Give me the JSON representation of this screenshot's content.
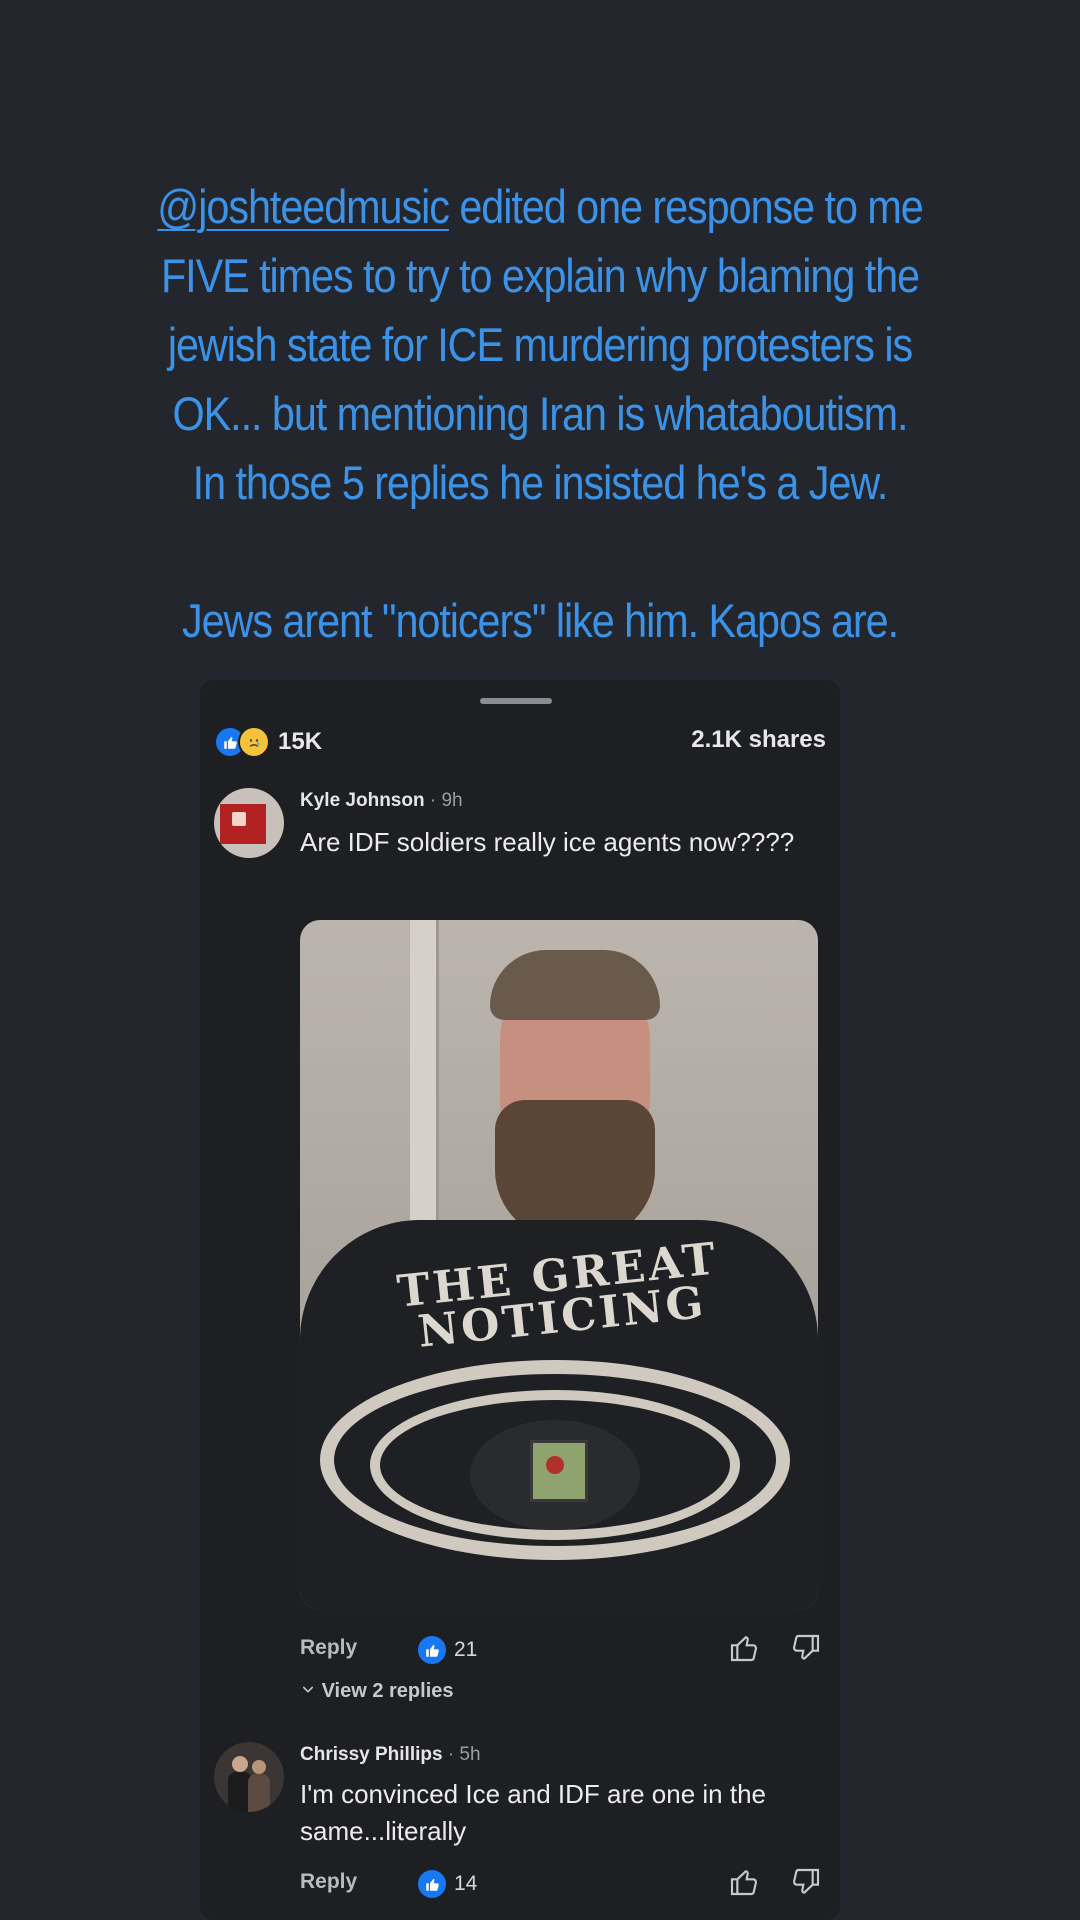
{
  "caption": {
    "mention": "@joshteedmusic",
    "line1_rest": " edited one response to me",
    "line2": "FIVE times to try to explain why blaming the",
    "line3": "jewish state for ICE murdering protesters is",
    "line4": "OK... but mentioning Iran is whataboutism.",
    "line5": "In those 5 replies he insisted he's a Jew.",
    "line6": "Jews arent \"noticers\" like him. Kapos are."
  },
  "post": {
    "reaction_count": "15K",
    "shares": "2.1K shares"
  },
  "comments": [
    {
      "name": "Kyle Johnson",
      "time": "· 9h",
      "text": "Are IDF soldiers really ice agents now????",
      "image_text": "THE GREAT NOTICING",
      "reply_label": "Reply",
      "likes": "21",
      "view_replies": "View 2 replies"
    },
    {
      "name": "Chrissy Phillips",
      "time": "· 5h",
      "text": "I'm convinced Ice and IDF are one in the same...literally",
      "reply_label": "Reply",
      "likes": "14"
    }
  ],
  "icons": {
    "like": "thumbs-up-icon",
    "sad": "sad-face-icon",
    "dislike": "thumbs-down-icon",
    "chevron": "chevron-down-icon"
  },
  "colors": {
    "caption_blue": "#3c92e6",
    "like_blue": "#1877f2",
    "background": "#23262c",
    "card": "#1d1f23"
  }
}
